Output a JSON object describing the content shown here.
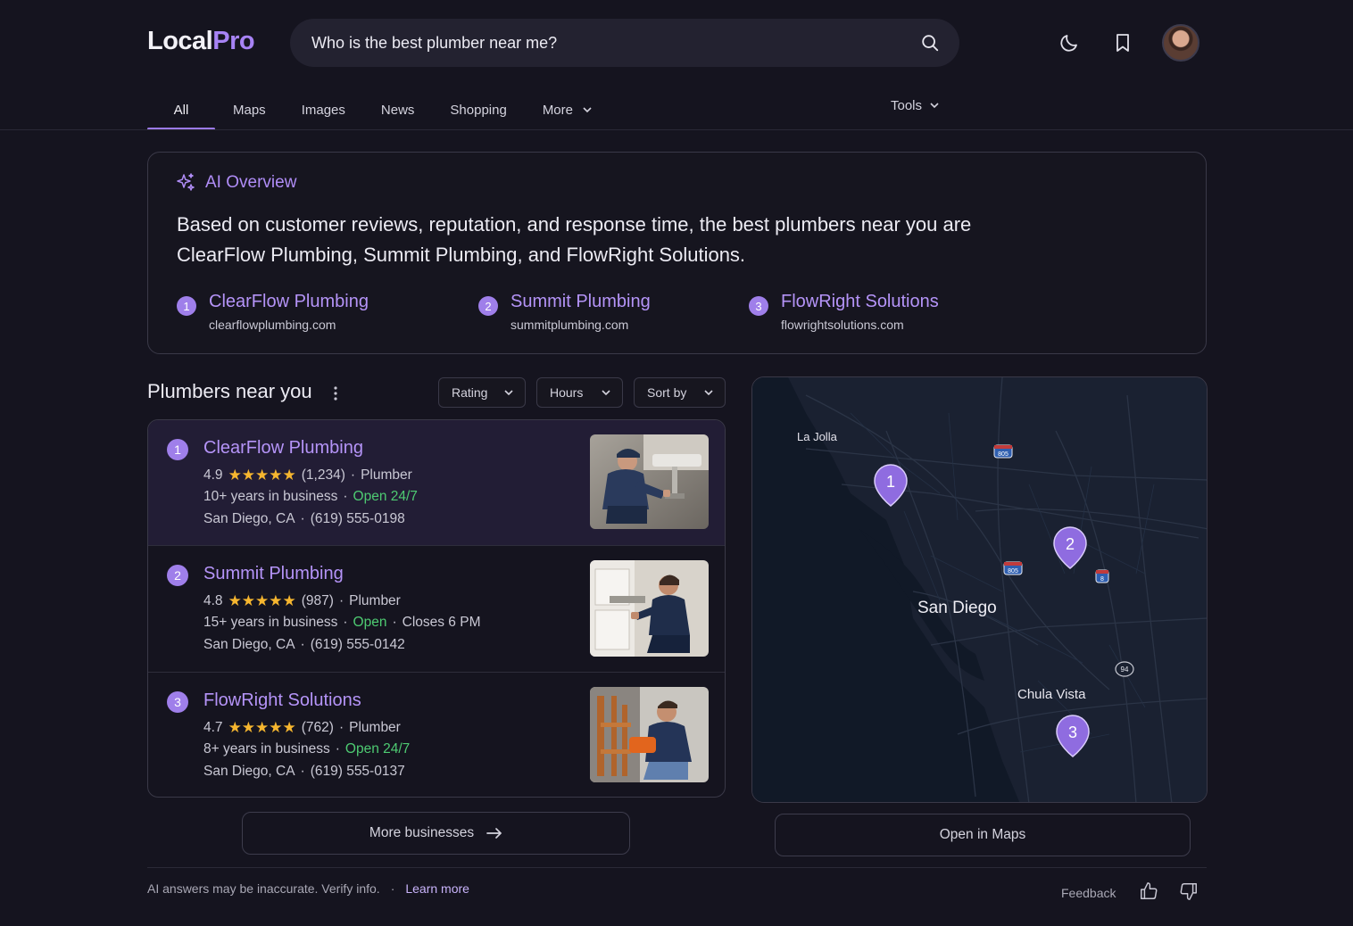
{
  "header": {
    "logo_part1": "Local",
    "logo_part2": "Pro",
    "search_value": "Who is the best plumber near me?"
  },
  "tabs": [
    {
      "label": "All",
      "active": true
    },
    {
      "label": "Maps"
    },
    {
      "label": "Images"
    },
    {
      "label": "News"
    },
    {
      "label": "Shopping"
    },
    {
      "label": "More"
    }
  ],
  "tools_label": "Tools",
  "ai_overview": {
    "title": "AI Overview",
    "line1": "Based on customer reviews, reputation, and response time, the best plumbers near you are",
    "line2": "ClearFlow Plumbing, Summit Plumbing, and FlowRight Solutions.",
    "sources": [
      {
        "num": "1",
        "name": "ClearFlow Plumbing",
        "domain": "clearflowplumbing.com"
      },
      {
        "num": "2",
        "name": "Summit Plumbing",
        "domain": "summitplumbing.com"
      },
      {
        "num": "3",
        "name": "FlowRight Solutions",
        "domain": "flowrightsolutions.com"
      }
    ]
  },
  "plumbers": {
    "title": "Plumbers near you",
    "filters": [
      "Rating",
      "Hours",
      "Sort by"
    ],
    "items": [
      {
        "num": "1",
        "name": "ClearFlow Plumbing",
        "rating": "4.9",
        "reviews": "(1,234)",
        "category": "Plumber",
        "years": "10+ years in business",
        "status": "Open 24/7",
        "closes": "",
        "city": "San Diego, CA",
        "phone": "(619) 555-0198"
      },
      {
        "num": "2",
        "name": "Summit Plumbing",
        "rating": "4.8",
        "reviews": "(987)",
        "category": "Plumber",
        "years": "15+ years in business",
        "status": "Open",
        "closes": "Closes 6 PM",
        "city": "San Diego, CA",
        "phone": "(619) 555-0142"
      },
      {
        "num": "3",
        "name": "FlowRight Solutions",
        "rating": "4.7",
        "reviews": "(762)",
        "category": "Plumber",
        "years": "8+ years in business",
        "status": "Open 24/7",
        "closes": "",
        "city": "San Diego, CA",
        "phone": "(619) 555-0137"
      }
    ],
    "more_label": "More businesses"
  },
  "map": {
    "labels": {
      "la_jolla": "La Jolla",
      "san_diego": "San Diego",
      "chula_vista": "Chula Vista"
    },
    "shields": {
      "i805a": "805",
      "i805b": "805",
      "i8": "8",
      "sr94": "94"
    },
    "pins": [
      "1",
      "2",
      "3"
    ],
    "open_label": "Open in Maps"
  },
  "footer": {
    "disclaimer": "AI answers may be inaccurate. Verify info.",
    "sep": "·",
    "learn_more": "Learn more",
    "feedback": "Feedback"
  },
  "colors": {
    "accent": "#9f7fea",
    "open": "#4ecb72",
    "star": "#f6b62f"
  },
  "icons": [
    "search-icon",
    "moon-icon",
    "bookmark-icon",
    "chevron-down-icon",
    "sparkle-icon",
    "kebab-icon",
    "arrow-right-icon",
    "thumbs-up-icon",
    "thumbs-down-icon",
    "map-pin-icon"
  ]
}
